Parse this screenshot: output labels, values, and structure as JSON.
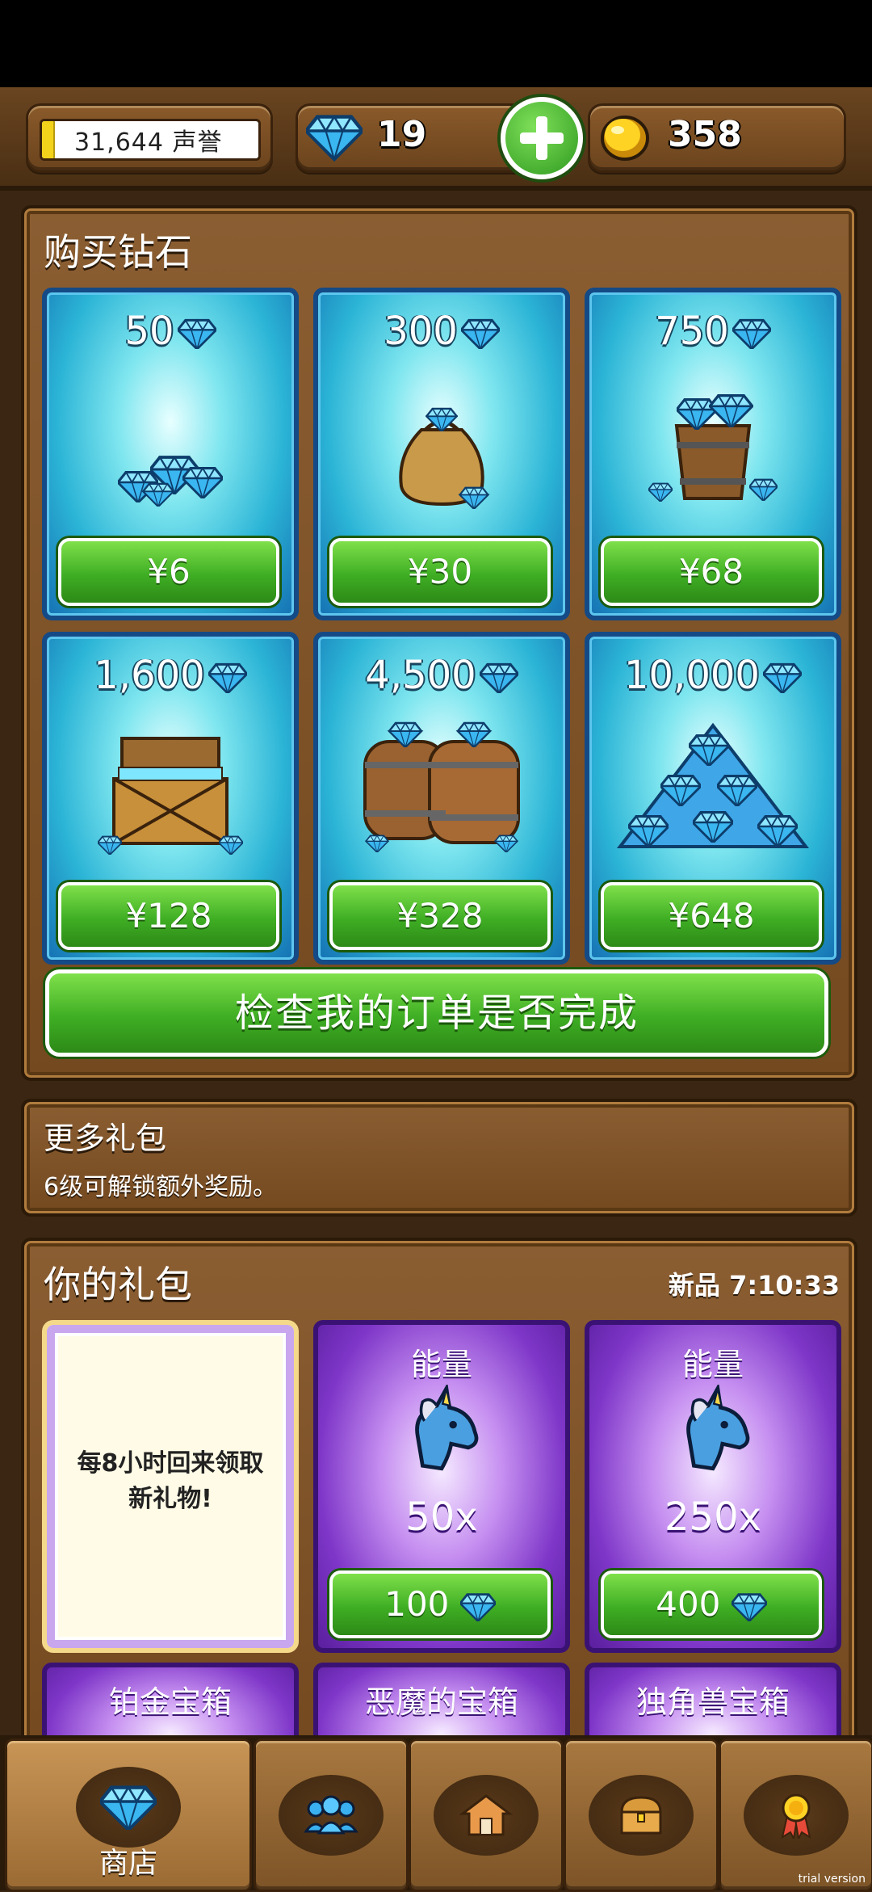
{
  "top_bar": {
    "reputation_text": "31,644 声誉",
    "gems": "19",
    "coins": "358"
  },
  "buy_diamonds": {
    "title": "购买钻石",
    "packs": [
      {
        "amount": "50",
        "price": "¥6"
      },
      {
        "amount": "300",
        "price": "¥30"
      },
      {
        "amount": "750",
        "price": "¥68"
      },
      {
        "amount": "1,600",
        "price": "¥128"
      },
      {
        "amount": "4,500",
        "price": "¥328"
      },
      {
        "amount": "10,000",
        "price": "¥648"
      }
    ],
    "check_orders": "检查我的订单是否完成"
  },
  "more_packs": {
    "title": "更多礼包",
    "subtitle": "6级可解锁额外奖励。"
  },
  "your_packs": {
    "title": "你的礼包",
    "timer": "新品 7:10:33",
    "free_card": "每8小时回来领取新礼物!",
    "items": [
      {
        "title": "能量",
        "qty": "50x",
        "price": "100"
      },
      {
        "title": "能量",
        "qty": "250x",
        "price": "400"
      }
    ],
    "chests": [
      "铂金宝箱",
      "恶魔的宝箱",
      "独角兽宝箱"
    ]
  },
  "nav": {
    "shop_label": "商店"
  },
  "trial_label": "trial version",
  "colors": {
    "wood": "#7d5427",
    "button_green": "#3fae24",
    "card_blue": "#2bb4d6",
    "card_purple": "#7e36c8"
  }
}
